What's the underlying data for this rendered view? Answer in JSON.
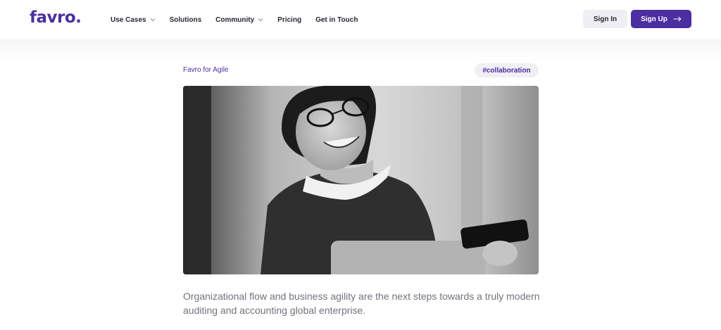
{
  "brand": {
    "logo_text": "favro.",
    "accent": "#4b2ea0"
  },
  "nav": {
    "items": [
      {
        "label": "Use Cases",
        "dropdown": true
      },
      {
        "label": "Solutions",
        "dropdown": false
      },
      {
        "label": "Community",
        "dropdown": true
      },
      {
        "label": "Pricing",
        "dropdown": false
      },
      {
        "label": "Get in Touch",
        "dropdown": false
      }
    ],
    "signin_label": "Sign In",
    "signup_label": "Sign Up"
  },
  "article": {
    "category": "Favro for Agile",
    "tag": "#collaboration",
    "hero_image": "woman-smiling-with-phone-and-laptop",
    "intro": "Organizational flow and business agility are the next steps towards a truly modern auditing and accounting global enterprise."
  }
}
